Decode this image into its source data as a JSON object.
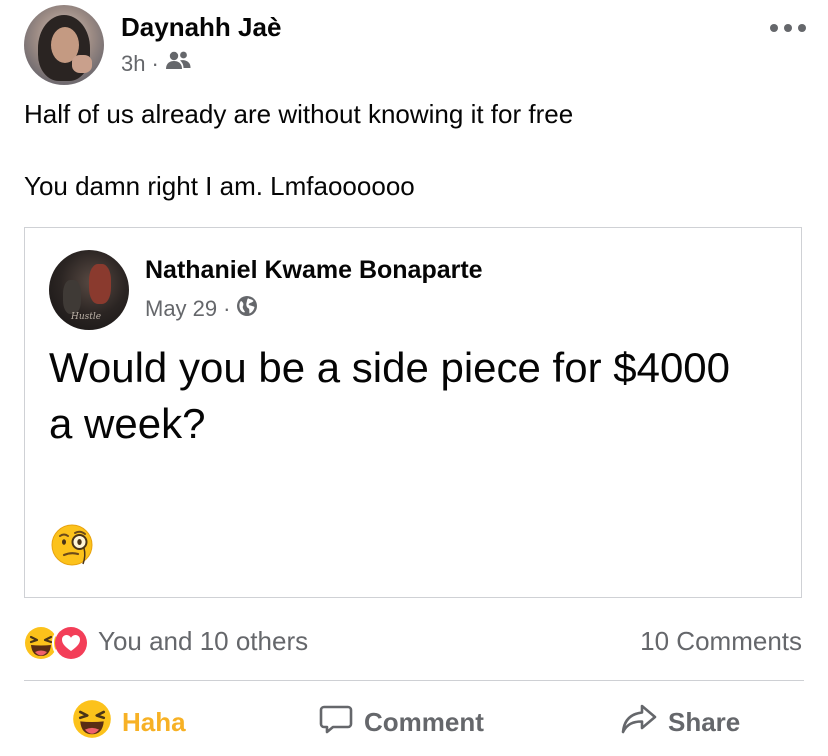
{
  "post": {
    "author": "Daynahh Jaè",
    "time": "3h",
    "separator": "·",
    "audience_icon": "friends-icon",
    "more_icon": "more-options-icon",
    "text_lines": [
      "Half of us already are without knowing it for free",
      "You damn right I am. Lmfaoooooo"
    ]
  },
  "shared_post": {
    "author": "Nathaniel Kwame Bonaparte",
    "date": "May 29",
    "separator": "·",
    "audience_icon": "globe-icon",
    "text": "Would you be a side piece for $4000 a week?",
    "emoji": "face-with-monocle"
  },
  "stats": {
    "reaction_icons": [
      "haha-reaction-icon",
      "love-reaction-icon"
    ],
    "reactions_text": "You and 10 others",
    "comments_text": "10 Comments"
  },
  "actions": {
    "haha_label": "Haha",
    "comment_label": "Comment",
    "share_label": "Share"
  },
  "colors": {
    "haha_active": "#f7b125",
    "secondary_text": "#65676b",
    "love": "#f33e58"
  }
}
